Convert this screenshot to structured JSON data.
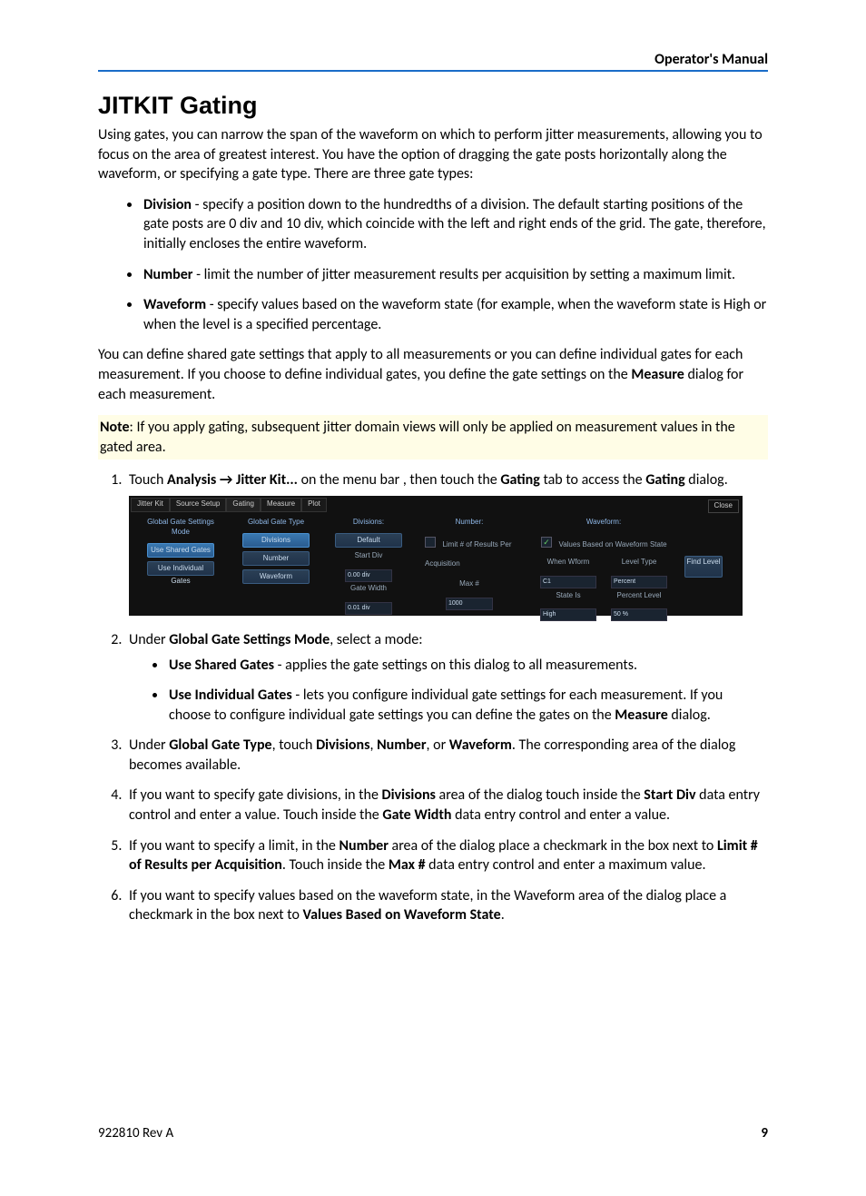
{
  "header": {
    "title": "Operator's Manual"
  },
  "h1": "JITKIT Gating",
  "intro": "Using gates, you can narrow the span of the waveform on which to perform jitter measurements, allowing you to focus on the area of greatest interest. You have the option of dragging the gate posts horizontally along the waveform, or specifying a gate type. There are three gate types:",
  "bullets": [
    {
      "term": "Division",
      "rest": " - specify a position down to the hundredths of a division. The default starting positions of the gate posts are 0 div and 10 div, which coincide with the left and right ends of the grid. The gate, therefore, initially encloses the entire waveform."
    },
    {
      "term": "Number",
      "rest": " - limit the number of jitter measurement results per acquisition by setting a maximum limit."
    },
    {
      "term": "Waveform",
      "rest": " - specify values based on the waveform state (for example, when the waveform state is High or when the level is a specified percentage."
    }
  ],
  "para_after_bullets": "You can define shared gate settings that apply to all measurements or you can define individual gates for each measurement. If you choose to define individual gates, you define the gate settings on the ",
  "para_after_bullets_bold": "Measure",
  "para_after_bullets_tail": " dialog for each measurement.",
  "note_label": "Note",
  "note_text": ": If you apply gating, subsequent jitter domain views will only be applied on measurement values in the gated area.",
  "step1": {
    "pre": "Touch ",
    "b1": "Analysis → Jitter Kit...",
    "mid": " on the menu bar , then touch the ",
    "b2": "Gating",
    "mid2": " tab to access the ",
    "b3": "Gating",
    "tail": " dialog."
  },
  "figure": {
    "tabs": [
      "Jitter Kit",
      "Source Setup",
      "Gating",
      "Measure",
      "Plot"
    ],
    "close": "Close",
    "col_mode": {
      "title": "Global Gate Settings Mode",
      "btn1": "Use Shared Gates",
      "btn2": "Use Individual Gates"
    },
    "col_type": {
      "title": "Global Gate Type",
      "b1": "Divisions",
      "b2": "Number",
      "b3": "Waveform"
    },
    "col_div": {
      "title": "Divisions:",
      "btn": "Default",
      "l1": "Start Div",
      "v1": "0.00 div",
      "l2": "Gate Width",
      "v2": "0.01 div"
    },
    "col_num": {
      "title": "Number:",
      "chk": "Limit # of Results Per Acquisition",
      "l1": "Max #",
      "v1": "1000"
    },
    "col_wf": {
      "title": "Waveform:",
      "chk": "Values Based on Waveform State",
      "l1": "When Wform",
      "l2": "Level Type",
      "v1": "C1",
      "v2": "Percent",
      "l3": "State Is",
      "l4": "Percent Level",
      "v3": "High",
      "v4": "50 %",
      "findbtn": "Find Level"
    }
  },
  "step2": {
    "pre": "Under ",
    "b1": "Global Gate Settings Mode",
    "tail": ", select a mode:",
    "sub": [
      {
        "term": "Use Shared Gates",
        "rest": " - applies the gate settings on this dialog to all measurements."
      },
      {
        "term": "Use Individual Gates",
        "rest_a": " - lets you configure individual gate settings for each measurement. If you choose to configure individual gate settings you can define the gates on the ",
        "b": "Measure",
        "rest_b": " dialog."
      }
    ]
  },
  "step3": {
    "pre": "Under ",
    "b1": "Global Gate Type",
    "mid": ", touch ",
    "b2": "Divisions",
    "c1": ", ",
    "b3": "Number",
    "c2": ", or ",
    "b4": "Waveform",
    "tail": ". The corresponding area of the dialog becomes available."
  },
  "step4": {
    "pre": "If you want to specify gate divisions, in the ",
    "b1": "Divisions",
    "mid": " area of the dialog touch inside the ",
    "b2": "Start Div",
    "mid2": " data entry control and enter a value. Touch inside the ",
    "b3": "Gate Width",
    "tail": " data entry control and enter a value."
  },
  "step5": {
    "pre": "If you want to specify a limit, in the ",
    "b1": "Number",
    "mid": " area of the dialog place a checkmark in the box next to ",
    "b2": "Limit # of Results per Acquisition",
    "mid2": ". Touch inside the ",
    "b3": "Max #",
    "tail": " data entry control and enter a maximum value."
  },
  "step6": {
    "pre": "If you want to specify values based on the waveform state, in the Waveform area of the dialog place a checkmark in the box next to ",
    "b1": "Values Based on Waveform State",
    "tail": "."
  },
  "footer": {
    "left": "922810 Rev A",
    "right": "9"
  }
}
